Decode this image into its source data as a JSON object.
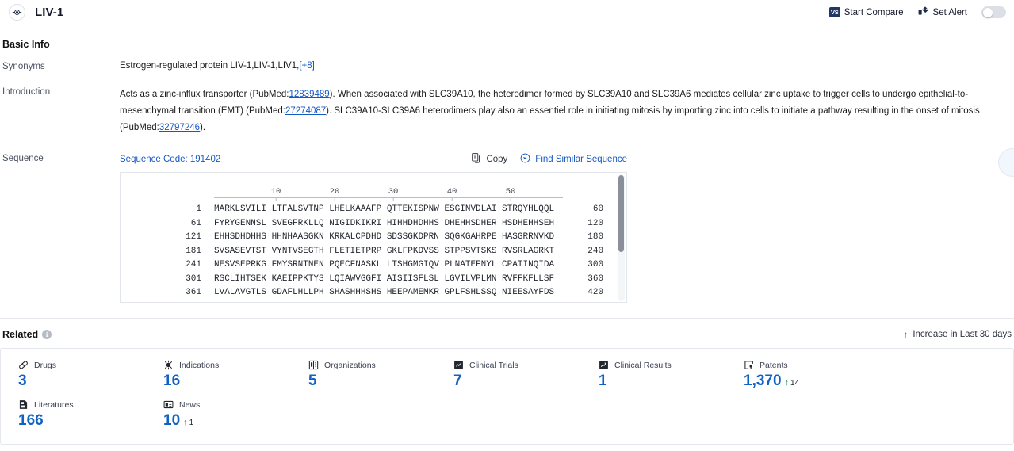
{
  "topbar": {
    "logo_icon": "target-icon",
    "title": "LIV-1",
    "start_compare": "Start Compare",
    "vs_badge": "VS",
    "set_alert": "Set Alert",
    "alert_icon": "alert-mail-icon",
    "toggle_state": "off"
  },
  "basic_info": {
    "heading": "Basic Info",
    "synonyms": {
      "label": "Synonyms",
      "value": "Estrogen-regulated protein LIV-1,LIV-1,LIV1,",
      "more": "[+8]"
    },
    "introduction": {
      "label": "Introduction",
      "part1": "Acts as a zinc-influx transporter (PubMed:",
      "link1": "12839489",
      "part2": "). When associated with SLC39A10, the heterodimer formed by SLC39A10 and SLC39A6 mediates cellular zinc uptake to trigger cells to undergo epithelial-to-mesenchymal transition (EMT) (PubMed:",
      "link2": "27274087",
      "part3": "). SLC39A10-SLC39A6 heterodimers play also an essentiel role in initiating mitosis by importing zinc into cells to initiate a pathway resulting in the onset of mitosis (PubMed:",
      "link3": "32797246",
      "part4": ")."
    },
    "sequence": {
      "label": "Sequence",
      "code_label": "Sequence Code: 191402",
      "copy_label": "Copy",
      "copy_icon": "copy-icon",
      "find_label": "Find Similar Sequence",
      "find_icon": "find-similar-icon",
      "ruler_ticks": [
        "10",
        "20",
        "30",
        "40",
        "50"
      ],
      "lines": [
        {
          "start": "1",
          "blocks": "MARKLSVILI LTFALSVTNP LHELKAAAFP QTTEKISPNW ESGINVDLAI STRQYHLQQL",
          "end": "60"
        },
        {
          "start": "61",
          "blocks": "FYRYGENNSL SVEGFRKLLQ NIGIDKIKRI HIHHDHDHHS DHEHHSDHER HSDHEHHSEH",
          "end": "120"
        },
        {
          "start": "121",
          "blocks": "EHHSDHDHHS HHNHAASGKN KRKALCPDHD SDSSGKDPRN SQGKGAHRPE HASGRRNVKD",
          "end": "180"
        },
        {
          "start": "181",
          "blocks": "SVSASEVTST VYNTVSEGTH FLETIETPRP GKLFPKDVSS STPPSVTSKS RVSRLAGRKT",
          "end": "240"
        },
        {
          "start": "241",
          "blocks": "NESVSEPRKG FMYSRNTNEN PQECFNASKL LTSHGMGIQV PLNATEFNYL CPAIINQIDA",
          "end": "300"
        },
        {
          "start": "301",
          "blocks": "RSCLIHTSEK KAEIPPKTYS LQIAWVGGFI AISIISFLSL LGVILVPLMN RVFFKFLLSF",
          "end": "360"
        },
        {
          "start": "361",
          "blocks": "LVALAVGTLS GDAFLHLLPH SHASHHHSHS HEEPAMEMKR GPLFSHLSSQ NIEESAYFDS",
          "end": "420"
        }
      ]
    }
  },
  "related": {
    "heading": "Related",
    "info_icon": "info-icon",
    "legend": "Increase in Last 30 days",
    "legend_arrow": "arrow-up-icon",
    "stats": [
      {
        "label": "Drugs",
        "icon": "pill-icon",
        "value": "3"
      },
      {
        "label": "Indications",
        "icon": "virus-icon",
        "value": "16"
      },
      {
        "label": "Organizations",
        "icon": "building-icon",
        "value": "5"
      },
      {
        "label": "Clinical Trials",
        "icon": "clinical-trial-icon",
        "value": "7"
      },
      {
        "label": "Clinical Results",
        "icon": "clinical-result-icon",
        "value": "1"
      },
      {
        "label": "Patents",
        "icon": "patent-icon",
        "value": "1,370",
        "delta": "14"
      },
      {
        "label": "Literatures",
        "icon": "literature-icon",
        "value": "166"
      },
      {
        "label": "News",
        "icon": "news-icon",
        "value": "10",
        "delta": "1"
      }
    ]
  },
  "colors": {
    "accent_blue": "#1161c4",
    "link_blue": "#1658c4",
    "increase_green": "#18883c",
    "navy": "#1f3864"
  }
}
